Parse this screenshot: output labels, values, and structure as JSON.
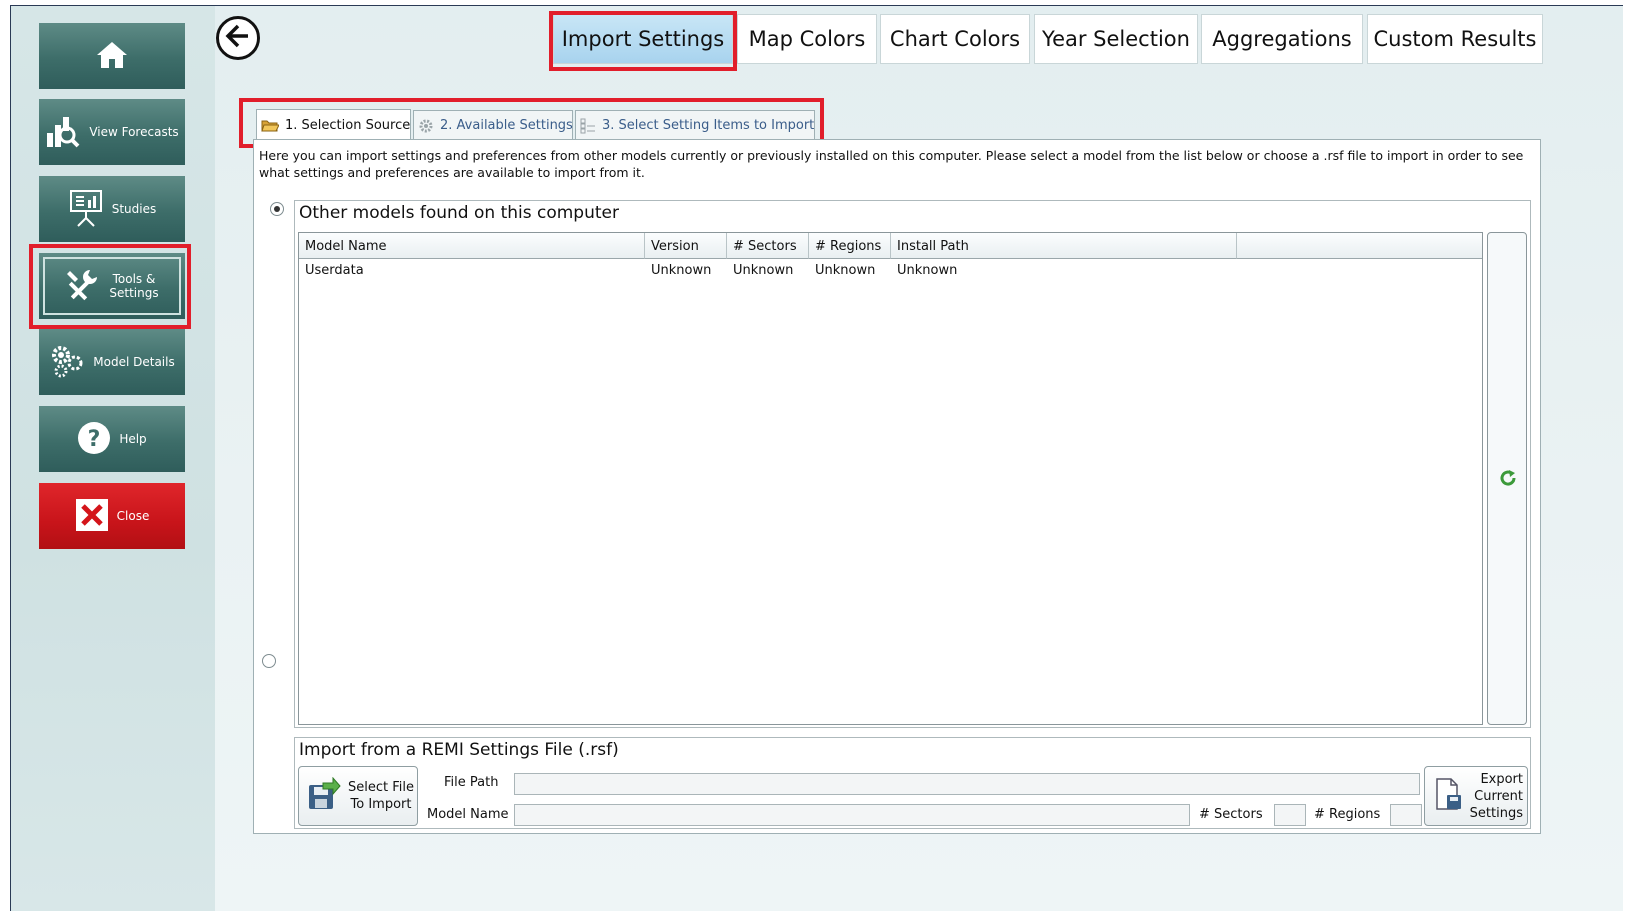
{
  "sidebar": {
    "items": [
      {
        "label": "",
        "icon": "home-icon"
      },
      {
        "label": "View Forecasts",
        "icon": "forecast-icon"
      },
      {
        "label": "Studies",
        "icon": "presentation-chart-icon"
      },
      {
        "label": "Tools & Settings",
        "icon": "tools-icon"
      },
      {
        "label": "Model Details",
        "icon": "gears-icon"
      },
      {
        "label": "Help",
        "icon": "help-icon"
      },
      {
        "label": "Close",
        "icon": "close-x-icon"
      }
    ]
  },
  "header": {
    "tabs": [
      "Import Settings",
      "Map Colors",
      "Chart Colors",
      "Year Selection",
      "Aggregations",
      "Custom Results"
    ]
  },
  "subtabs": [
    "1. Selection Source",
    "2. Available Settings",
    "3. Select Setting Items to Import"
  ],
  "description": "Here you can import settings and preferences from other models currently or previously installed on this computer.  Please select a model from the list below or choose a .rsf file to import in order to see what settings and preferences are available to import from it.",
  "models_group": {
    "title": "Other models found on this computer",
    "columns": [
      "Model Name",
      "Version",
      "# Sectors",
      "# Regions",
      "Install Path"
    ],
    "rows": [
      [
        "Userdata",
        "Unknown",
        "Unknown",
        "Unknown",
        "Unknown"
      ]
    ]
  },
  "rsf_group": {
    "title": "Import from a REMI Settings File (.rsf)",
    "select_button": "Select File To Import",
    "file_path_label": "File Path",
    "file_path_value": "",
    "model_name_label": "Model Name",
    "model_name_value": "",
    "sectors_label": "# Sectors",
    "sectors_value": "",
    "regions_label": "# Regions",
    "regions_value": "",
    "export_button": "Export Current Settings"
  },
  "colors": {
    "highlight": "#e11e2b",
    "nav_teal": "#3d6d69",
    "close_red": "#c8141a",
    "active_tab": "#a8d3ee"
  }
}
